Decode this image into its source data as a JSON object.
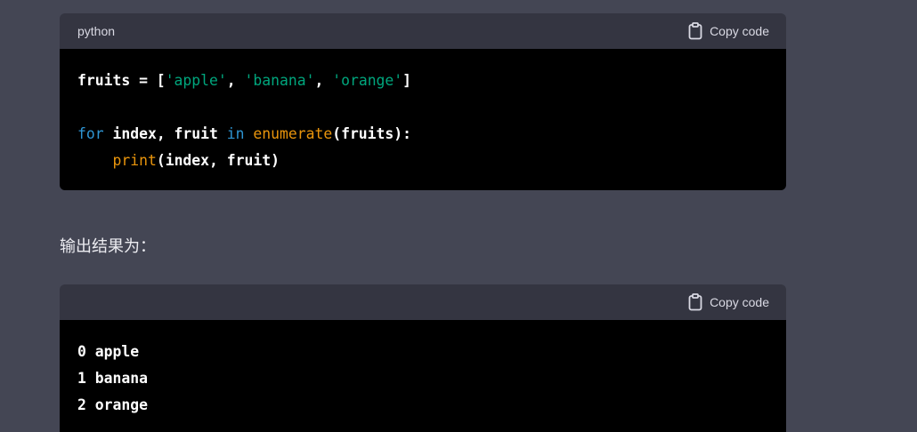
{
  "code_block_1": {
    "language": "python",
    "copy_label": "Copy code",
    "lines": [
      {
        "tokens": [
          {
            "t": "plain",
            "v": "fruits = ["
          },
          {
            "t": "str",
            "v": "'apple'"
          },
          {
            "t": "plain",
            "v": ", "
          },
          {
            "t": "str",
            "v": "'banana'"
          },
          {
            "t": "plain",
            "v": ", "
          },
          {
            "t": "str",
            "v": "'orange'"
          },
          {
            "t": "plain",
            "v": "]"
          }
        ]
      },
      {
        "tokens": []
      },
      {
        "tokens": [
          {
            "t": "kw",
            "v": "for"
          },
          {
            "t": "plain",
            "v": " index, fruit "
          },
          {
            "t": "kw",
            "v": "in"
          },
          {
            "t": "plain",
            "v": " "
          },
          {
            "t": "builtin",
            "v": "enumerate"
          },
          {
            "t": "plain",
            "v": "(fruits):"
          }
        ]
      },
      {
        "tokens": [
          {
            "t": "plain",
            "v": "    "
          },
          {
            "t": "builtin",
            "v": "print"
          },
          {
            "t": "plain",
            "v": "(index, fruit)"
          }
        ]
      }
    ]
  },
  "prose_text": "输出结果为：",
  "code_block_2": {
    "language": "",
    "copy_label": "Copy code",
    "lines": [
      {
        "tokens": [
          {
            "t": "plain",
            "v": "0 apple"
          }
        ]
      },
      {
        "tokens": [
          {
            "t": "plain",
            "v": "1 banana"
          }
        ]
      },
      {
        "tokens": [
          {
            "t": "plain",
            "v": "2 orange"
          }
        ]
      }
    ]
  },
  "colors": {
    "page_background": "#444654",
    "code_header": "#343541",
    "code_body": "#000000",
    "string": "#00a67d",
    "keyword": "#2e95d3",
    "builtin": "#e9950c"
  },
  "icons": {
    "copy": "clipboard-icon"
  }
}
